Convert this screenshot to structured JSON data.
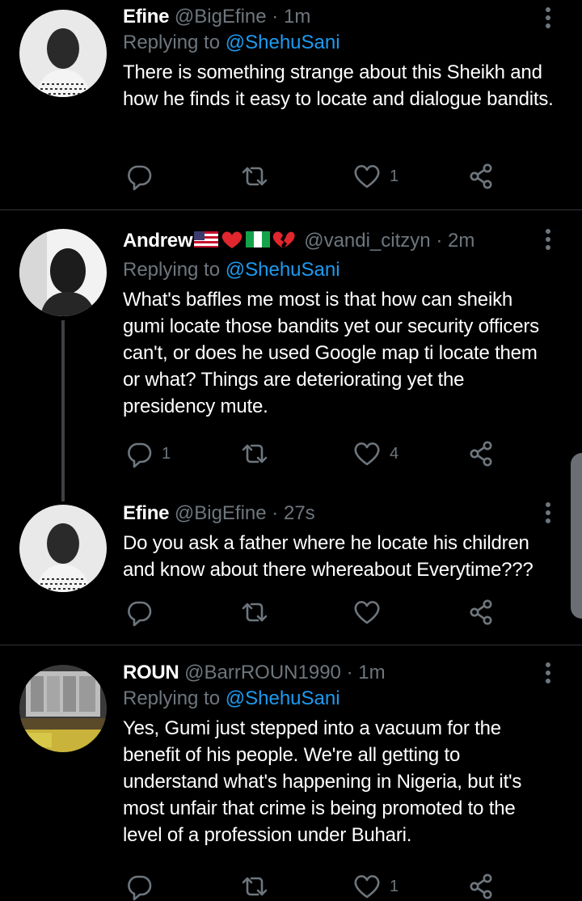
{
  "tweets": [
    {
      "name": "Efine",
      "handle": "@BigEfine",
      "separator": "·",
      "time": "1m",
      "replying_prefix": "Replying to",
      "replying_to": "@ShehuSani",
      "text": "There is something strange about this Sheikh and how he finds it easy to locate and dialogue bandits.",
      "reply_count": "",
      "retweet_count": "",
      "like_count": "1"
    },
    {
      "name": "Andrew",
      "name_emojis": [
        "us-flag-emoji",
        "red-heart-emoji",
        "nigeria-flag-emoji",
        "broken-heart-emoji"
      ],
      "handle": "@vandi_citzyn",
      "separator": "·",
      "time": "2m",
      "replying_prefix": "Replying to",
      "replying_to": "@ShehuSani",
      "text": "What's baffles me most is that how can sheikh gumi locate those bandits yet our security officers can't, or does he used Google map ti locate them or what? Things are deteriorating yet the presidency mute.",
      "reply_count": "1",
      "retweet_count": "",
      "like_count": "4"
    },
    {
      "name": "Efine",
      "handle": "@BigEfine",
      "separator": "·",
      "time": "27s",
      "text": "Do you ask a father where he locate his children and know about there whereabout Everytime???",
      "reply_count": "",
      "retweet_count": "",
      "like_count": ""
    },
    {
      "name": "ROUN",
      "handle": "@BarrROUN1990",
      "separator": "·",
      "time": "1m",
      "replying_prefix": "Replying to",
      "replying_to": "@ShehuSani",
      "text": "Yes, Gumi just stepped into a vacuum for the benefit of his people. We're all getting to understand what's happening in Nigeria, but it's most unfair that crime is being promoted to the level of a profession under Buhari.",
      "reply_count": "",
      "retweet_count": "",
      "like_count": "1"
    }
  ],
  "icons": {
    "reply": "reply-icon",
    "retweet": "retweet-icon",
    "like": "heart-icon",
    "share": "share-icon",
    "more": "more-vertical-icon"
  },
  "colors": {
    "background": "#000000",
    "text": "#ffffff",
    "secondary": "#6e767d",
    "mention": "#1d9bf0",
    "divider": "#2f3336"
  }
}
